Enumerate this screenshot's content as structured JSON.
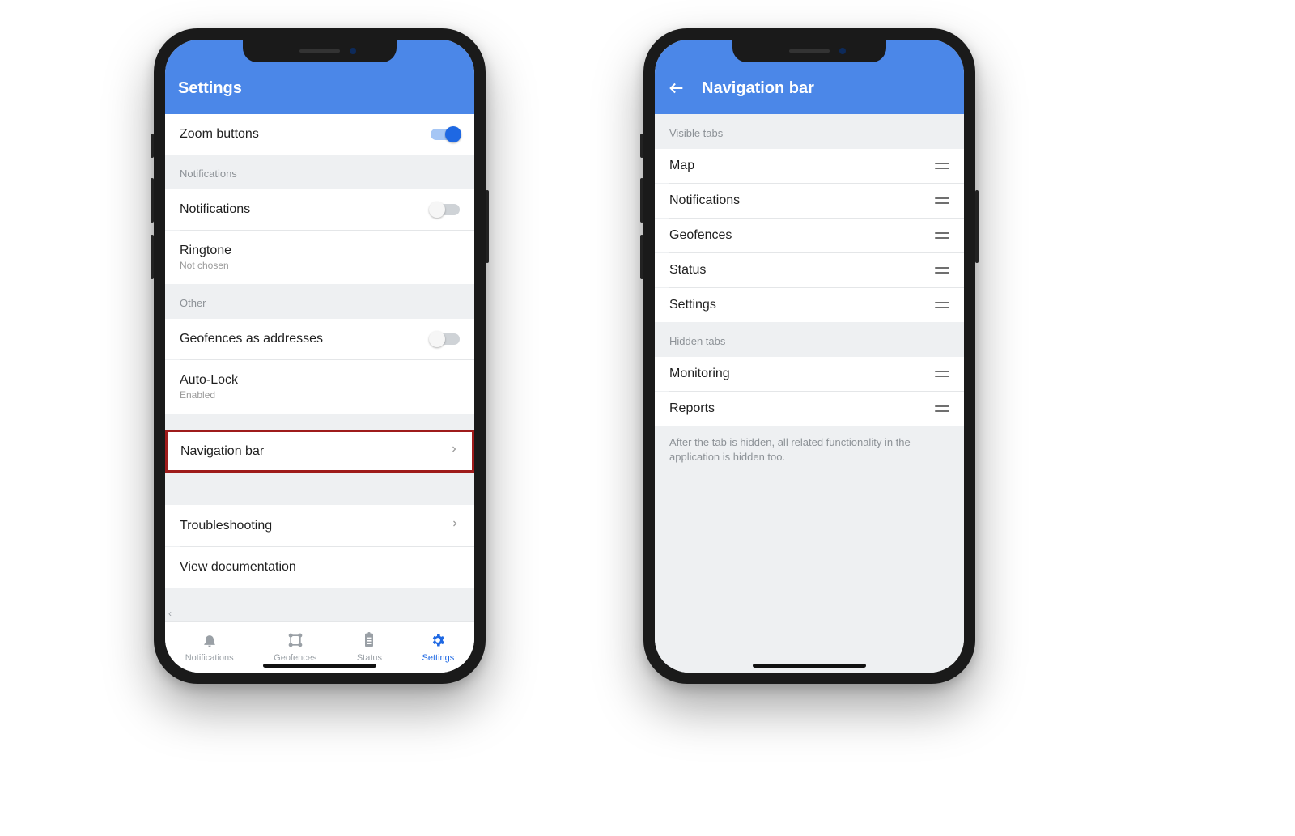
{
  "colors": {
    "accent": "#4b87e8",
    "active": "#1e68e3",
    "highlight": "#9e1b1b"
  },
  "left": {
    "title": "Settings",
    "zoom_label": "Zoom buttons",
    "zoom_on": true,
    "section_notifications": "Notifications",
    "notifications_label": "Notifications",
    "notifications_on": false,
    "ringtone_label": "Ringtone",
    "ringtone_value": "Not chosen",
    "section_other": "Other",
    "geofences_addr_label": "Geofences as addresses",
    "geofences_addr_on": false,
    "autolock_label": "Auto-Lock",
    "autolock_value": "Enabled",
    "navbar_label": "Navigation bar",
    "troubleshooting_label": "Troubleshooting",
    "docs_label": "View documentation",
    "tabs": {
      "notifications": "Notifications",
      "geofences": "Geofences",
      "status": "Status",
      "settings": "Settings"
    }
  },
  "right": {
    "title": "Navigation bar",
    "section_visible": "Visible tabs",
    "visible": [
      {
        "label": "Map"
      },
      {
        "label": "Notifications"
      },
      {
        "label": "Geofences"
      },
      {
        "label": "Status"
      },
      {
        "label": "Settings"
      }
    ],
    "section_hidden": "Hidden tabs",
    "hidden": [
      {
        "label": "Monitoring"
      },
      {
        "label": "Reports"
      }
    ],
    "hint": "After the tab is hidden, all related functionality in the application is hidden too."
  }
}
